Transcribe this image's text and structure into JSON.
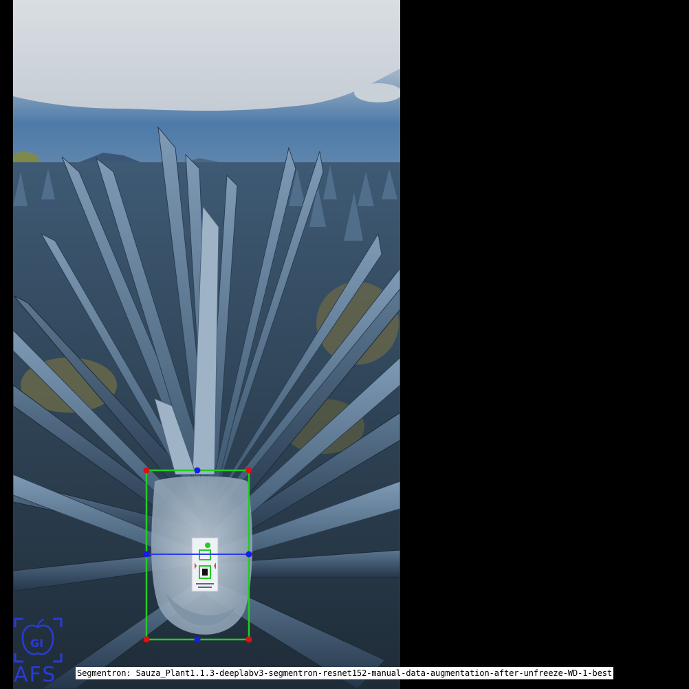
{
  "caption": "Segmentron: Sauza_Plant1.1.3-deeplabv3-segmentron-resnet152-manual-data-augmentation-after-unfreeze-WD-1-best",
  "logo": {
    "text": "AFS",
    "badge": "GI",
    "color": "#2b3bd6"
  },
  "annotation": {
    "box_color": "#22cc22",
    "corner_color": "#dd1111",
    "midpoint_color": "#1a1aee",
    "midline_color": "#2a3af0"
  }
}
